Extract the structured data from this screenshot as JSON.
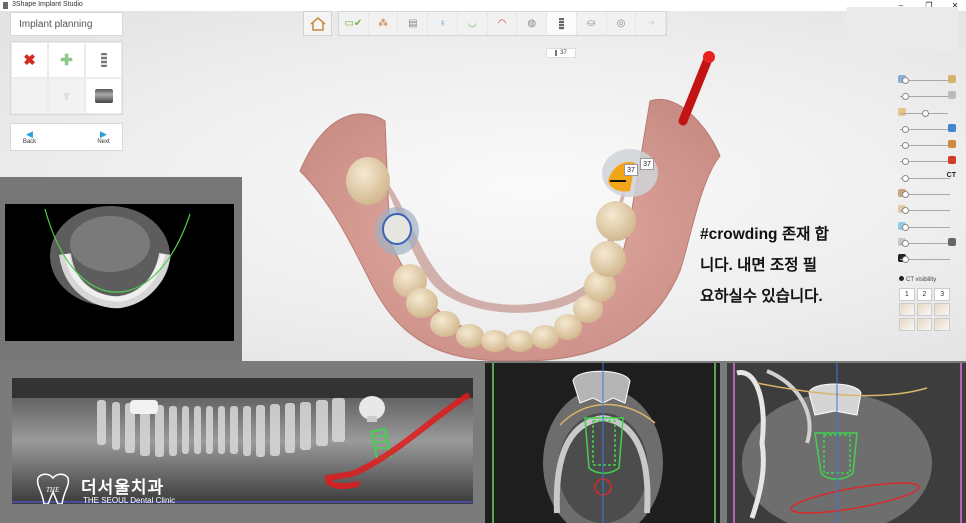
{
  "window": {
    "title": "3Shape Implant Studio",
    "controls": [
      "minimize",
      "maximize",
      "close"
    ]
  },
  "plan_panel": {
    "title": "Implant planning",
    "tools": [
      {
        "icon": "delete-x-icon",
        "enabled": true,
        "color": "#d42a20"
      },
      {
        "icon": "add-plus-icon",
        "enabled": true,
        "color": "#8fc88c"
      },
      {
        "icon": "implant-icon",
        "enabled": true
      },
      {
        "icon": "empty-icon",
        "enabled": false
      },
      {
        "icon": "tooth-icon",
        "enabled": false
      },
      {
        "icon": "sleeve-icon",
        "enabled": true
      }
    ],
    "back_label": "Back",
    "next_label": "Next"
  },
  "toolbar": {
    "home_icon": "home-icon",
    "steps": [
      {
        "icon": "order-check-icon"
      },
      {
        "icon": "scan-align-icon"
      },
      {
        "icon": "ct-slice-icon"
      },
      {
        "icon": "nerve-icon"
      },
      {
        "icon": "arch-icon"
      },
      {
        "icon": "crown-arch-icon"
      },
      {
        "icon": "tooth-crown-icon"
      },
      {
        "icon": "implant-step-icon",
        "active": true
      },
      {
        "icon": "guide-icon"
      },
      {
        "icon": "drill-sphere-icon"
      },
      {
        "icon": "export-icon",
        "enabled": false
      }
    ],
    "step_tooltip": "37"
  },
  "sliders": [
    {
      "icon": "pin-icon",
      "value": 0.05,
      "end_icon": "bridge-icon"
    },
    {
      "icon": "",
      "value": 0.05,
      "end_icon": "line-icon"
    },
    {
      "icon": "crown-icon",
      "value": 0.5,
      "end_icon": "tooth-white-icon"
    },
    {
      "icon": "",
      "value": 0.05,
      "end_icon": "blue-cylinder-icon"
    },
    {
      "icon": "",
      "value": 0.05,
      "end_icon": "orange-cylinder-icon"
    },
    {
      "icon": "",
      "value": 0.05,
      "end_icon": "red-drill-icon"
    },
    {
      "icon": "",
      "value": 0.05,
      "end_text": "CT"
    },
    {
      "icon": "sleeve-small-icon",
      "value": 0.05
    },
    {
      "icon": "bone-icon",
      "value": 0.05
    },
    {
      "icon": "dot-icon",
      "value": 0.05
    },
    {
      "icon": "eraser-icon",
      "value": 0.05,
      "end_icon": "sun-icon"
    },
    {
      "icon": "contrast-icon",
      "value": 0.05
    }
  ],
  "ct_visibility": {
    "label": "CT visibility",
    "buttons": [
      "1",
      "2",
      "3"
    ]
  },
  "model": {
    "implant_label_a": "37",
    "implant_label_b": "37"
  },
  "caption": [
    "#crowding 존재 합",
    "니다. 내면 조정 필",
    "요하실수 있습니다."
  ],
  "watermark": {
    "name_ko": "더서울치과",
    "name_en": "THE SEOUL Dental Clinic",
    "logo_text": "THE"
  },
  "colors": {
    "implant_green": "#42d14e",
    "drill_red": "#e01b1b",
    "nerve_red": "#d82a2a",
    "accent_blue": "#2aa3d8",
    "crown_orange": "#f2a516"
  }
}
